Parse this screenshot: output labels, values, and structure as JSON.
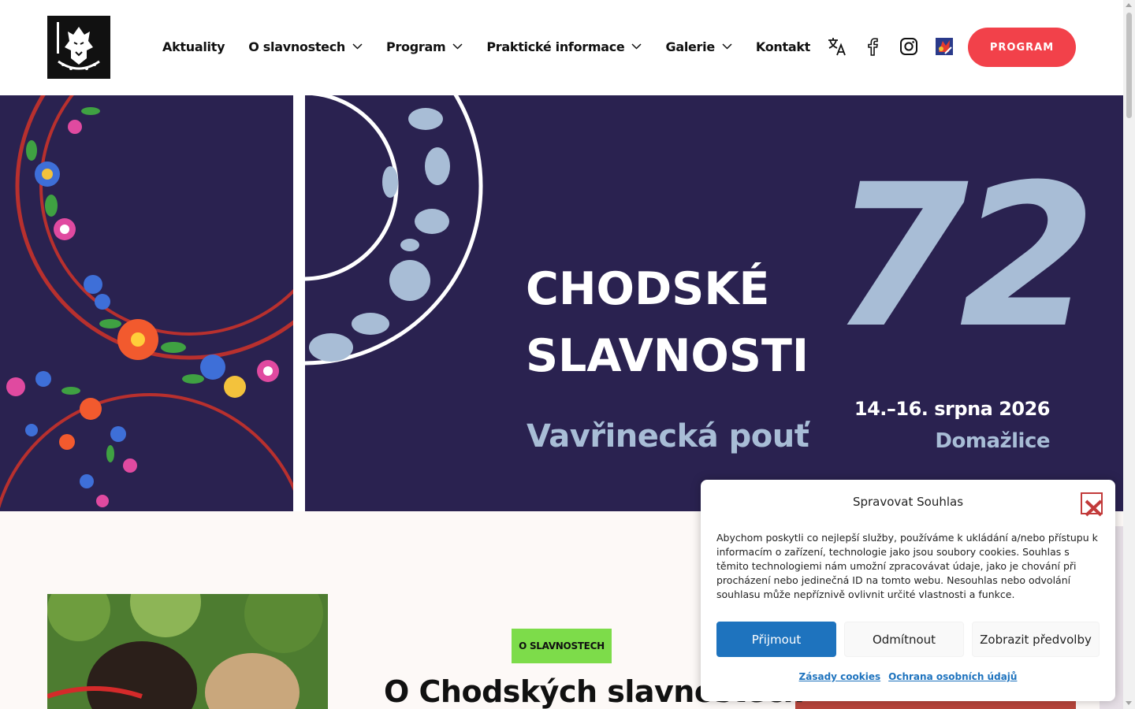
{
  "header": {
    "nav": [
      {
        "label": "Aktuality",
        "dropdown": false
      },
      {
        "label": "O slavnostech",
        "dropdown": true
      },
      {
        "label": "Program",
        "dropdown": true
      },
      {
        "label": "Praktické informace",
        "dropdown": true
      },
      {
        "label": "Galerie",
        "dropdown": true
      },
      {
        "label": "Kontakt",
        "dropdown": false
      }
    ],
    "social_icons": [
      "translate-icon",
      "facebook-icon",
      "instagram-icon",
      "partner-logo-icon"
    ],
    "cta_label": "PROGRAM"
  },
  "hero": {
    "title_line1": "CHODSKÉ",
    "title_line2": "SLAVNOSTI",
    "subtitle": "Vavřinecká pouť",
    "edition": "72",
    "dates": "14.–16. srpna 2026",
    "place": "Domažlice"
  },
  "section": {
    "tag": "O SLAVNOSTECH",
    "title": "O Chodských slavnostech"
  },
  "cookie": {
    "title": "Spravovat Souhlas",
    "text": "Abychom poskytli co nejlepší služby, používáme k ukládání a/nebo přístupu k informacím o zařízení, technologie jako jsou soubory cookies. Souhlas s těmito technologiemi nám umožní zpracovávat údaje, jako je chování při procházení nebo jedinečná ID na tomto webu. Nesouhlas nebo odvolání souhlasu může nepříznivě ovlivnit určité vlastnosti a funkce.",
    "accept": "Přijmout",
    "deny": "Odmítnout",
    "preferences": "Zobrazit předvolby",
    "link_cookies": "Zásady cookies",
    "link_privacy": "Ochrana osobních údajů"
  },
  "colors": {
    "accent": "#f2414a",
    "hero_bg": "#2a2250",
    "hero_light": "#a8bdd6",
    "tag": "#7ddc4a",
    "primary_button": "#1e73be"
  }
}
